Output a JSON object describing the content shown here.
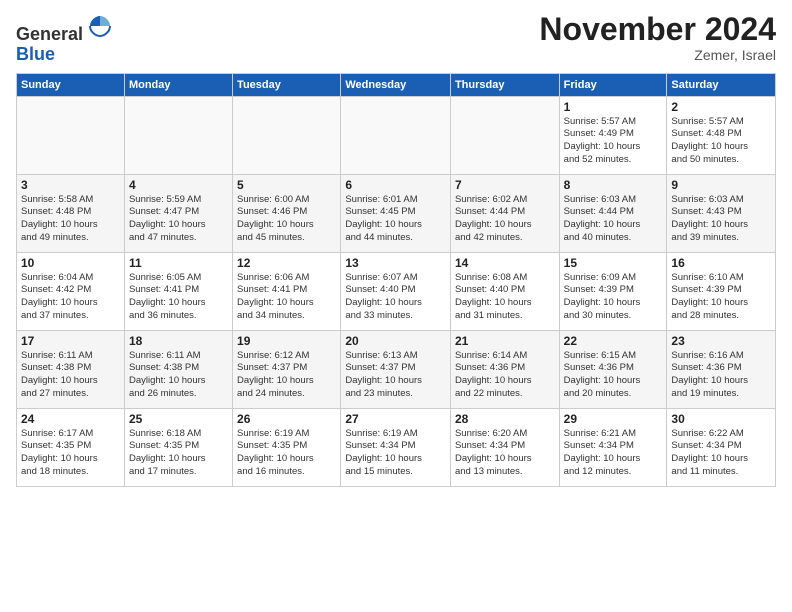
{
  "header": {
    "logo_line1": "General",
    "logo_line2": "Blue",
    "month_title": "November 2024",
    "location": "Zemer, Israel"
  },
  "weekdays": [
    "Sunday",
    "Monday",
    "Tuesday",
    "Wednesday",
    "Thursday",
    "Friday",
    "Saturday"
  ],
  "weeks": [
    [
      {
        "day": "",
        "info": ""
      },
      {
        "day": "",
        "info": ""
      },
      {
        "day": "",
        "info": ""
      },
      {
        "day": "",
        "info": ""
      },
      {
        "day": "",
        "info": ""
      },
      {
        "day": "1",
        "info": "Sunrise: 5:57 AM\nSunset: 4:49 PM\nDaylight: 10 hours\nand 52 minutes."
      },
      {
        "day": "2",
        "info": "Sunrise: 5:57 AM\nSunset: 4:48 PM\nDaylight: 10 hours\nand 50 minutes."
      }
    ],
    [
      {
        "day": "3",
        "info": "Sunrise: 5:58 AM\nSunset: 4:48 PM\nDaylight: 10 hours\nand 49 minutes."
      },
      {
        "day": "4",
        "info": "Sunrise: 5:59 AM\nSunset: 4:47 PM\nDaylight: 10 hours\nand 47 minutes."
      },
      {
        "day": "5",
        "info": "Sunrise: 6:00 AM\nSunset: 4:46 PM\nDaylight: 10 hours\nand 45 minutes."
      },
      {
        "day": "6",
        "info": "Sunrise: 6:01 AM\nSunset: 4:45 PM\nDaylight: 10 hours\nand 44 minutes."
      },
      {
        "day": "7",
        "info": "Sunrise: 6:02 AM\nSunset: 4:44 PM\nDaylight: 10 hours\nand 42 minutes."
      },
      {
        "day": "8",
        "info": "Sunrise: 6:03 AM\nSunset: 4:44 PM\nDaylight: 10 hours\nand 40 minutes."
      },
      {
        "day": "9",
        "info": "Sunrise: 6:03 AM\nSunset: 4:43 PM\nDaylight: 10 hours\nand 39 minutes."
      }
    ],
    [
      {
        "day": "10",
        "info": "Sunrise: 6:04 AM\nSunset: 4:42 PM\nDaylight: 10 hours\nand 37 minutes."
      },
      {
        "day": "11",
        "info": "Sunrise: 6:05 AM\nSunset: 4:41 PM\nDaylight: 10 hours\nand 36 minutes."
      },
      {
        "day": "12",
        "info": "Sunrise: 6:06 AM\nSunset: 4:41 PM\nDaylight: 10 hours\nand 34 minutes."
      },
      {
        "day": "13",
        "info": "Sunrise: 6:07 AM\nSunset: 4:40 PM\nDaylight: 10 hours\nand 33 minutes."
      },
      {
        "day": "14",
        "info": "Sunrise: 6:08 AM\nSunset: 4:40 PM\nDaylight: 10 hours\nand 31 minutes."
      },
      {
        "day": "15",
        "info": "Sunrise: 6:09 AM\nSunset: 4:39 PM\nDaylight: 10 hours\nand 30 minutes."
      },
      {
        "day": "16",
        "info": "Sunrise: 6:10 AM\nSunset: 4:39 PM\nDaylight: 10 hours\nand 28 minutes."
      }
    ],
    [
      {
        "day": "17",
        "info": "Sunrise: 6:11 AM\nSunset: 4:38 PM\nDaylight: 10 hours\nand 27 minutes."
      },
      {
        "day": "18",
        "info": "Sunrise: 6:11 AM\nSunset: 4:38 PM\nDaylight: 10 hours\nand 26 minutes."
      },
      {
        "day": "19",
        "info": "Sunrise: 6:12 AM\nSunset: 4:37 PM\nDaylight: 10 hours\nand 24 minutes."
      },
      {
        "day": "20",
        "info": "Sunrise: 6:13 AM\nSunset: 4:37 PM\nDaylight: 10 hours\nand 23 minutes."
      },
      {
        "day": "21",
        "info": "Sunrise: 6:14 AM\nSunset: 4:36 PM\nDaylight: 10 hours\nand 22 minutes."
      },
      {
        "day": "22",
        "info": "Sunrise: 6:15 AM\nSunset: 4:36 PM\nDaylight: 10 hours\nand 20 minutes."
      },
      {
        "day": "23",
        "info": "Sunrise: 6:16 AM\nSunset: 4:36 PM\nDaylight: 10 hours\nand 19 minutes."
      }
    ],
    [
      {
        "day": "24",
        "info": "Sunrise: 6:17 AM\nSunset: 4:35 PM\nDaylight: 10 hours\nand 18 minutes."
      },
      {
        "day": "25",
        "info": "Sunrise: 6:18 AM\nSunset: 4:35 PM\nDaylight: 10 hours\nand 17 minutes."
      },
      {
        "day": "26",
        "info": "Sunrise: 6:19 AM\nSunset: 4:35 PM\nDaylight: 10 hours\nand 16 minutes."
      },
      {
        "day": "27",
        "info": "Sunrise: 6:19 AM\nSunset: 4:34 PM\nDaylight: 10 hours\nand 15 minutes."
      },
      {
        "day": "28",
        "info": "Sunrise: 6:20 AM\nSunset: 4:34 PM\nDaylight: 10 hours\nand 13 minutes."
      },
      {
        "day": "29",
        "info": "Sunrise: 6:21 AM\nSunset: 4:34 PM\nDaylight: 10 hours\nand 12 minutes."
      },
      {
        "day": "30",
        "info": "Sunrise: 6:22 AM\nSunset: 4:34 PM\nDaylight: 10 hours\nand 11 minutes."
      }
    ]
  ]
}
